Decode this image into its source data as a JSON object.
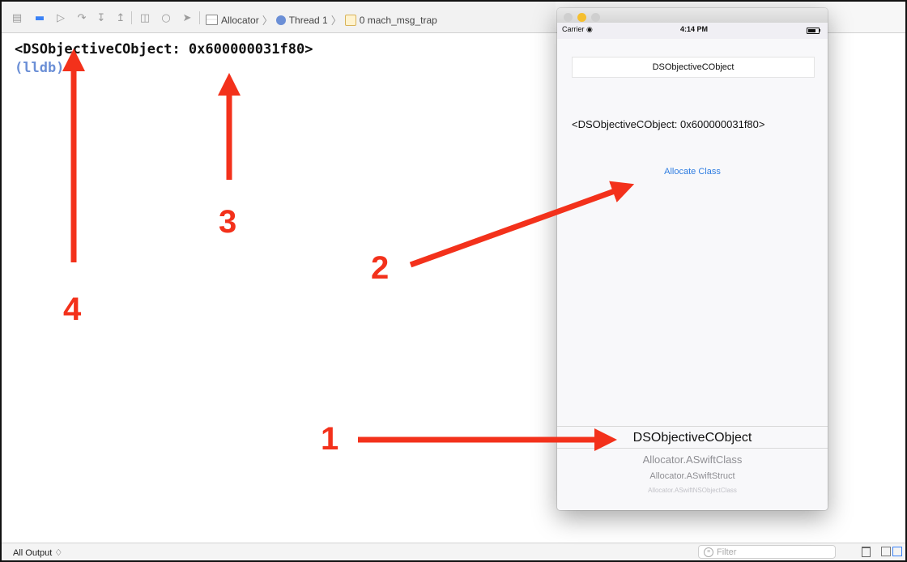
{
  "debug_bar": {
    "breadcrumb": {
      "target": "Allocator",
      "thread": "Thread 1",
      "frame": "0 mach_msg_trap"
    }
  },
  "console": {
    "output_line": "<DSObjectiveCObject: 0x600000031f80>",
    "prompt": "(lldb)"
  },
  "bottom_bar": {
    "output_selector": "All Output ♢",
    "filter_placeholder": "Filter"
  },
  "simulator": {
    "status": {
      "carrier": "Carrier ◉",
      "time": "4:14 PM"
    },
    "class_field_value": "DSObjectiveCObject",
    "object_label": "<DSObjectiveCObject: 0x600000031f80>",
    "allocate_button": "Allocate Class",
    "picker": [
      "DSObjectiveCObject",
      "Allocator.ASwiftClass",
      "Allocator.ASwiftStruct",
      "Allocator.ASwiftNSObjectClass"
    ]
  },
  "annotations": {
    "one": "1",
    "two": "2",
    "three": "3",
    "four": "4",
    "color": "#f3311b"
  }
}
